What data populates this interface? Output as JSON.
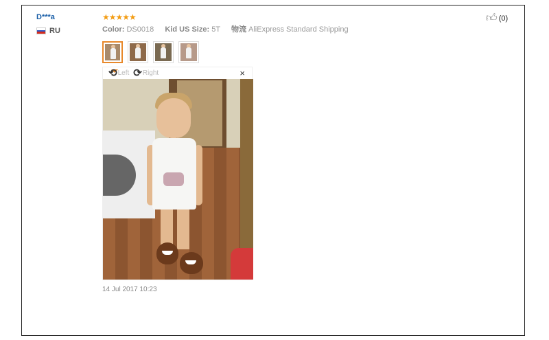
{
  "review": {
    "buyer": {
      "name": "D***a",
      "country": "RU"
    },
    "rating_text": "★★★★★",
    "attributes": [
      {
        "label": "Color:",
        "value": "DS0018"
      },
      {
        "label": "Kid US Size:",
        "value": "5T"
      },
      {
        "label": "物流",
        "value": "AliExpress Standard Shipping"
      }
    ],
    "viewer": {
      "rotate_left_label": "Left",
      "rotate_right_label": "Right",
      "close_label": "×"
    },
    "date": "14 Jul 2017 10:23",
    "helpful_count": "(0)"
  },
  "icons": {
    "rotate_left": "rotate-left-icon",
    "rotate_right": "rotate-right-icon",
    "close": "close-icon",
    "thumbs_up": "thumbs-up-icon",
    "flag": "russia-flag-icon"
  },
  "colors": {
    "buyer_name": "#1a5fa8",
    "star": "#f39c12",
    "active_thumb": "#e8882a"
  }
}
